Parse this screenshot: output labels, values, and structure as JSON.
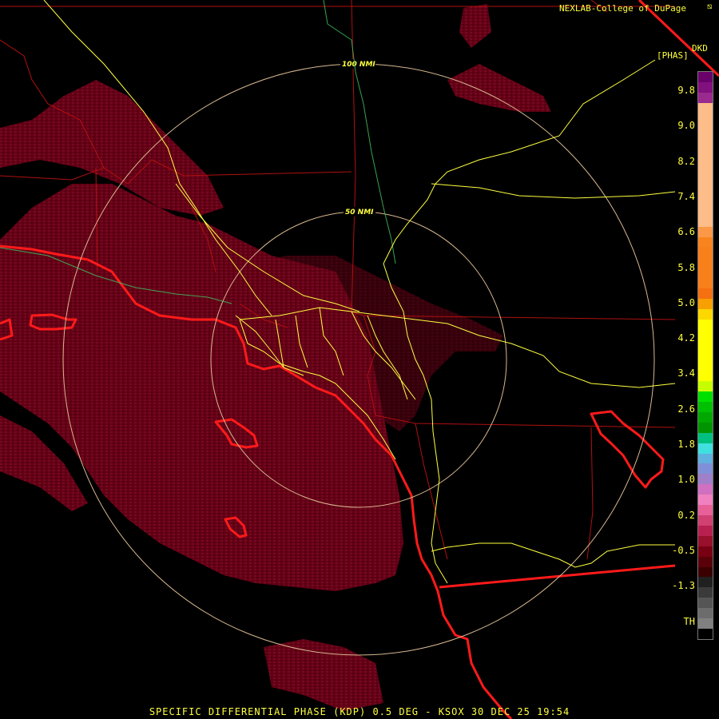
{
  "credit": "NEXLAB-College of DuPage",
  "legend": {
    "product": "DKD",
    "unit": "[PHAS]",
    "ticks": [
      "9.8",
      "9.0",
      "8.2",
      "7.4",
      "6.6",
      "5.8",
      "5.0",
      "4.2",
      "3.4",
      "2.6",
      "1.8",
      "1.0",
      "0.2",
      "-0.5",
      "-1.3",
      "TH"
    ],
    "colors": [
      "#6a006a",
      "#82107e",
      "#9a2a8e",
      "#fdbc88",
      "#fdbc88",
      "#fdbc88",
      "#fdbc88",
      "#fdbc88",
      "#fdbc88",
      "#fdbc88",
      "#fdbc88",
      "#fdbc88",
      "#fdbc88",
      "#fdbc88",
      "#fdbc88",
      "#fb9848",
      "#f8841e",
      "#f8801a",
      "#f8801a",
      "#f8801a",
      "#f8801a",
      "#f47010",
      "#f7a000",
      "#fcd800",
      "#ffff00",
      "#ffff00",
      "#ffff00",
      "#ffff00",
      "#ffff00",
      "#ffff00",
      "#c8ff00",
      "#00e000",
      "#00c000",
      "#00a800",
      "#009400",
      "#00c080",
      "#40e0e0",
      "#60b0e0",
      "#8090d8",
      "#a080c8",
      "#d070c0",
      "#f080c0",
      "#e86098",
      "#d04070",
      "#b82050",
      "#98102c",
      "#780012",
      "#5a0008",
      "#3a0000",
      "#202020",
      "#3a3a3a",
      "#555555",
      "#6c6c6c",
      "#808080",
      "#000000"
    ]
  },
  "rings": [
    {
      "label": "100 NMI"
    },
    {
      "label": "50 NMI"
    }
  ],
  "footer": "SPECIFIC DIFFERENTIAL PHASE (KDP) 0.5 DEG - KSOX 30 DEC 25 19:54",
  "map_colors": {
    "background": "#000000",
    "echo": "#6e0018",
    "echo_bright": "#8a0a2a",
    "coast": "#ff1a1a",
    "county": "#b01010",
    "highway": "#ffff40",
    "river": "#40c060",
    "range_ring": "#d8b890"
  }
}
